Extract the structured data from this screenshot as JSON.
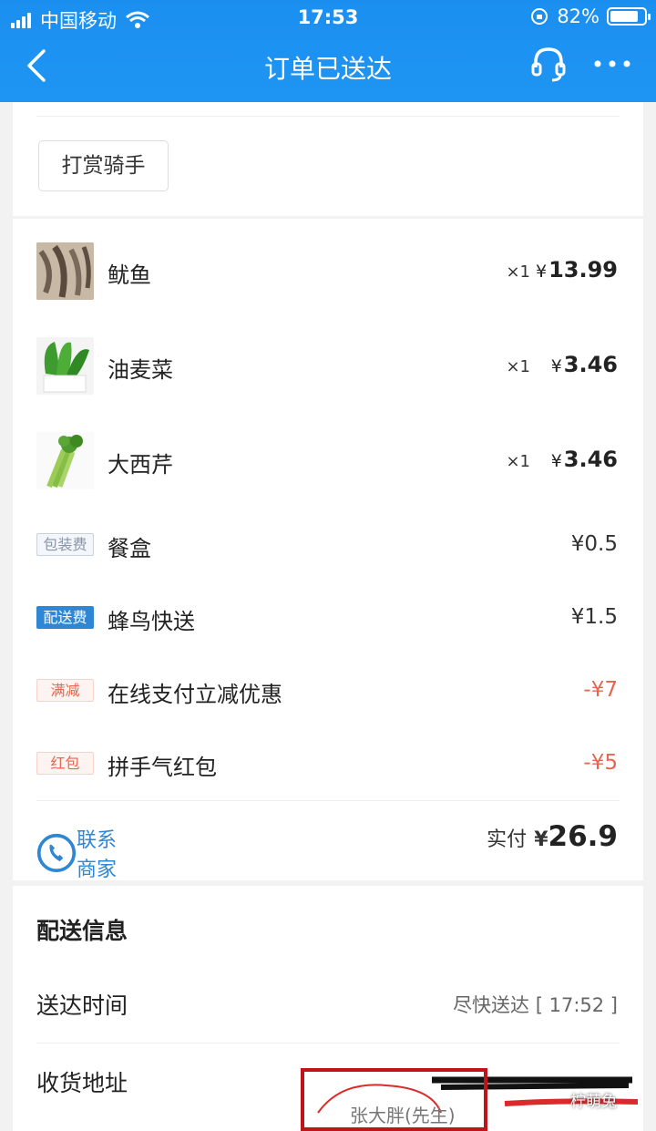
{
  "status_bar": {
    "carrier": "中国移动",
    "time": "17:53",
    "battery": "82%",
    "battery_fraction": 0.82
  },
  "nav": {
    "title": "订单已送达"
  },
  "tip": {
    "label": "打赏骑手"
  },
  "items": [
    {
      "name": "鱿鱼",
      "qty": "×1",
      "price": "13.99",
      "currency": "¥"
    },
    {
      "name": "油麦菜",
      "qty": "×1",
      "price": "3.46",
      "currency": "¥"
    },
    {
      "name": "大西芹",
      "qty": "×1",
      "price": "3.46",
      "currency": "¥"
    }
  ],
  "fees": [
    {
      "tag": "包装费",
      "name": "餐盒",
      "amount": "¥0.5"
    },
    {
      "tag": "配送费",
      "name": "蜂鸟快送",
      "amount": "¥1.5"
    },
    {
      "tag": "满减",
      "name": "在线支付立减优惠",
      "amount": "-¥7"
    },
    {
      "tag": "红包",
      "name": "拼手气红包",
      "amount": "-¥5"
    }
  ],
  "contact": {
    "label": "联系商家"
  },
  "total": {
    "label": "实付",
    "currency": "¥",
    "amount": "26.9"
  },
  "delivery": {
    "title": "配送信息",
    "time_label": "送达时间",
    "time_value": "尽快送达 [ 17:52 ]",
    "address_label": "收货地址",
    "recipient": "张大胖(先生)"
  },
  "watermark": "柠萌兔",
  "colors": {
    "header": "#1a8ff0",
    "accent_blue": "#2f86d3",
    "discount": "#e4674f",
    "highlight_box": "#c0141b"
  }
}
